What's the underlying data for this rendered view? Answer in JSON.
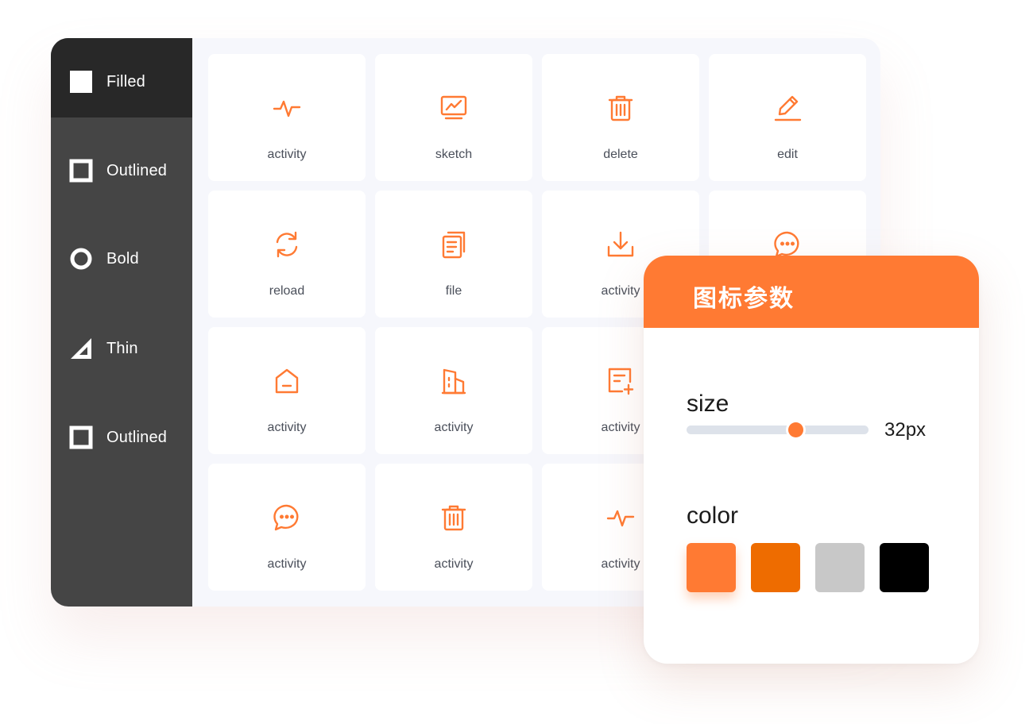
{
  "sidebar": {
    "items": [
      {
        "label": "Filled",
        "icon": "filled-square-icon",
        "active": true
      },
      {
        "label": "Outlined",
        "icon": "outlined-square-icon",
        "active": false
      },
      {
        "label": "Bold",
        "icon": "ring-icon",
        "active": false
      },
      {
        "label": "Thin",
        "icon": "triangle-ruler-icon",
        "active": false
      },
      {
        "label": "Outlined",
        "icon": "outlined-square-icon",
        "active": false
      }
    ]
  },
  "grid": {
    "icon_color": "#ff7a33",
    "tiles": [
      {
        "label": "activity",
        "icon": "activity-icon"
      },
      {
        "label": "sketch",
        "icon": "sketch-chart-icon"
      },
      {
        "label": "delete",
        "icon": "trash-icon"
      },
      {
        "label": "edit",
        "icon": "pencil-icon"
      },
      {
        "label": "reload",
        "icon": "reload-icon"
      },
      {
        "label": "file",
        "icon": "file-icon"
      },
      {
        "label": "activity",
        "icon": "download-icon"
      },
      {
        "label": "",
        "icon": "chat-icon"
      },
      {
        "label": "activity",
        "icon": "home-icon"
      },
      {
        "label": "activity",
        "icon": "building-icon"
      },
      {
        "label": "activity",
        "icon": "note-add-icon"
      },
      {
        "label": "",
        "icon": ""
      },
      {
        "label": "activity",
        "icon": "chat-icon"
      },
      {
        "label": "activity",
        "icon": "trash-icon"
      },
      {
        "label": "activity",
        "icon": "activity-icon"
      },
      {
        "label": "",
        "icon": ""
      }
    ]
  },
  "panel": {
    "title": "图标参数",
    "size": {
      "label": "size",
      "value_text": "32px",
      "level": 0.6
    },
    "color": {
      "label": "color",
      "swatches": [
        "#ff7a33",
        "#ee6c00",
        "#c8c8c8",
        "#000000"
      ],
      "selected_index": 0
    }
  }
}
